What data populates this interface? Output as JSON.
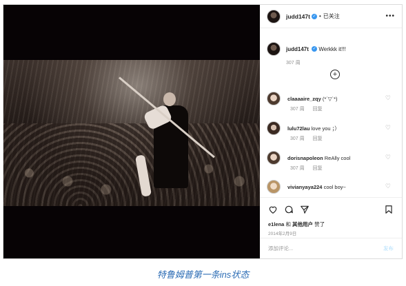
{
  "post": {
    "author": "judd147t",
    "follow_label": "已关注",
    "dot": "•",
    "more": "•••",
    "caption": {
      "user": "judd147t",
      "text": "Werkkk it!!!",
      "meta": "307 周"
    }
  },
  "comments": [
    {
      "user": "claaaaire_zqy",
      "text": "(*´▽`*)",
      "time": "307 周",
      "reply": "回复"
    },
    {
      "user": "lulu72lau",
      "text": "love you ；）",
      "time": "307 周",
      "reply": "回复"
    },
    {
      "user": "dorisnapoleon",
      "text": "ReAlly cool",
      "time": "307 周",
      "reply": "回复"
    },
    {
      "user": "vivianyaya224",
      "text": "cool boy~",
      "time": "",
      "reply": ""
    }
  ],
  "actions": {
    "likes_user": "e1lena",
    "likes_and": "和",
    "likes_others": "其他用户",
    "likes_suffix": "赞了",
    "date": "2014年2月9日"
  },
  "add_comment": {
    "placeholder": "添加评论...",
    "post_label": "发布"
  },
  "figure_caption": "特鲁姆普第一条ins状态",
  "colors": {
    "verified": "#3897f0",
    "caption": "#2d6db5",
    "post_disabled": "#b2dffc"
  }
}
